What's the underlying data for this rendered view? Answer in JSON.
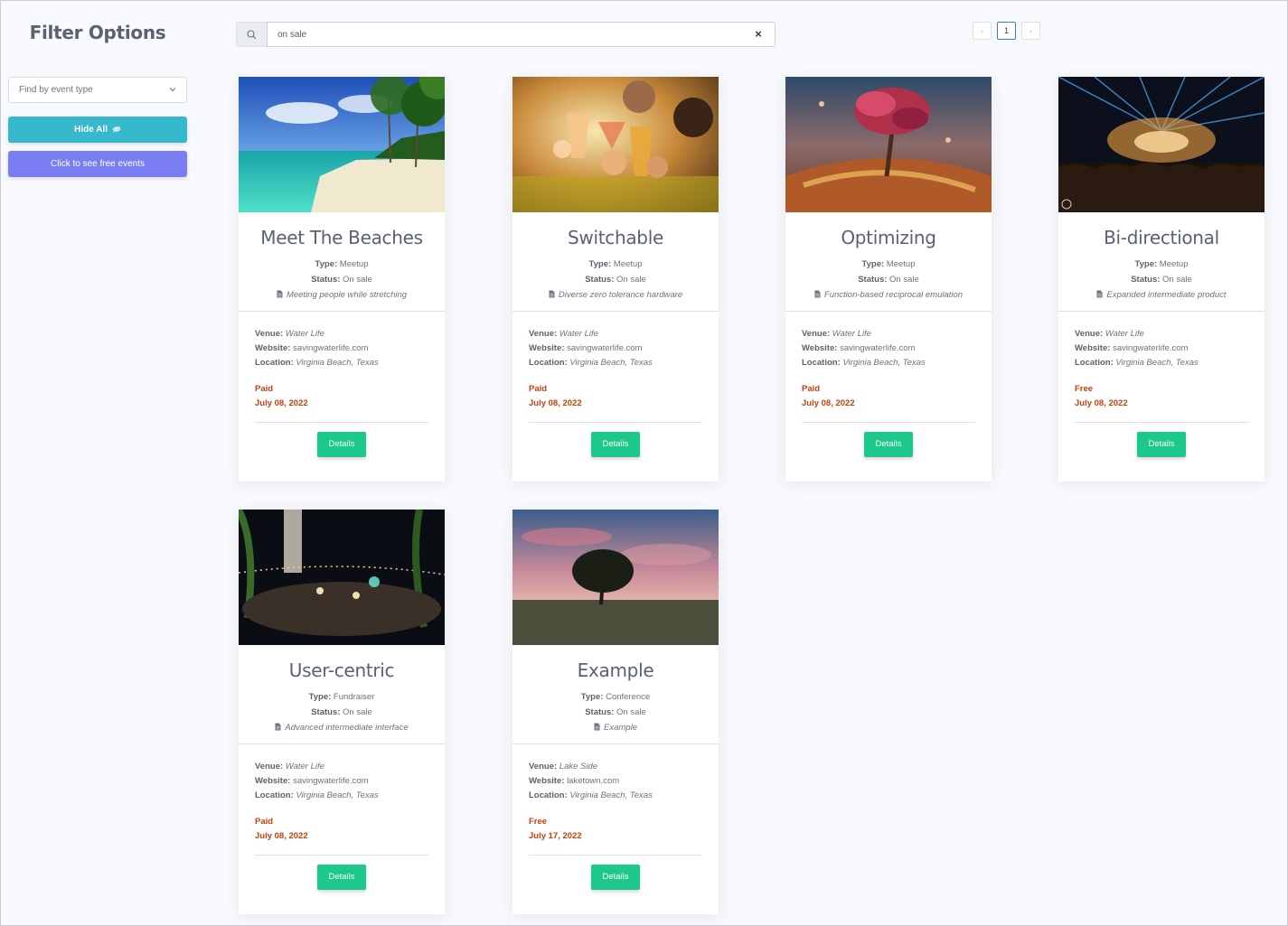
{
  "sidebar": {
    "title": "Filter Options",
    "event_type_placeholder": "Find by event type",
    "hide_all_label": "Hide All",
    "free_events_label": "Click to see free events"
  },
  "search": {
    "value": "on sale",
    "clear_label": "×"
  },
  "pagination": {
    "prev": "‹",
    "current": "1",
    "next": "›"
  },
  "labels": {
    "type": "Type:",
    "status": "Status:",
    "venue": "Venue:",
    "website": "Website:",
    "location": "Location:",
    "details": "Details"
  },
  "events": [
    {
      "title": "Meet The Beaches",
      "type": "Meetup",
      "status": "On sale",
      "description": "Meeting people while stretching",
      "venue": "Water Life",
      "website": "savingwaterlife.com",
      "location": "Virginia Beach, Texas",
      "price": "Paid",
      "date": "July 08, 2022",
      "image": "beach-photo"
    },
    {
      "title": "Switchable",
      "type": "Meetup",
      "status": "On sale",
      "description": "Diverse zero tolerance hardware",
      "venue": "Water Life",
      "website": "savingwaterlife.com",
      "location": "Virginia Beach, Texas",
      "price": "Paid",
      "date": "July 08, 2022",
      "image": "drinks-toast-photo"
    },
    {
      "title": "Optimizing",
      "type": "Meetup",
      "status": "On sale",
      "description": "Function-based reciprocal emulation",
      "venue": "Water Life",
      "website": "savingwaterlife.com",
      "location": "Virginia Beach, Texas",
      "price": "Paid",
      "date": "July 08, 2022",
      "image": "fantasy-tree-painting"
    },
    {
      "title": "Bi-directional",
      "type": "Meetup",
      "status": "On sale",
      "description": "Expanded intermediate product",
      "venue": "Water Life",
      "website": "savingwaterlife.com",
      "location": "Virginia Beach, Texas",
      "price": "Free",
      "date": "July 08, 2022",
      "image": "concert-crowd-photo"
    },
    {
      "title": "User-centric",
      "type": "Fundraiser",
      "status": "On sale",
      "description": "Advanced intermediate interface",
      "venue": "Water Life",
      "website": "savingwaterlife.com",
      "location": "Virginia Beach, Texas",
      "price": "Paid",
      "date": "July 08, 2022",
      "image": "night-festival-photo"
    },
    {
      "title": "Example",
      "type": "Conference",
      "status": "On sale",
      "description": "Example",
      "venue": "Lake Side",
      "website": "laketown.com",
      "location": "Virginia Beach, Texas",
      "price": "Free",
      "date": "July 17, 2022",
      "image": "tree-sunset-photo"
    }
  ],
  "colors": {
    "accent_cyan": "#36b9cc",
    "accent_purple": "#7b7ef2",
    "details_green": "#1cc88a",
    "price_orange": "#c2410c"
  }
}
